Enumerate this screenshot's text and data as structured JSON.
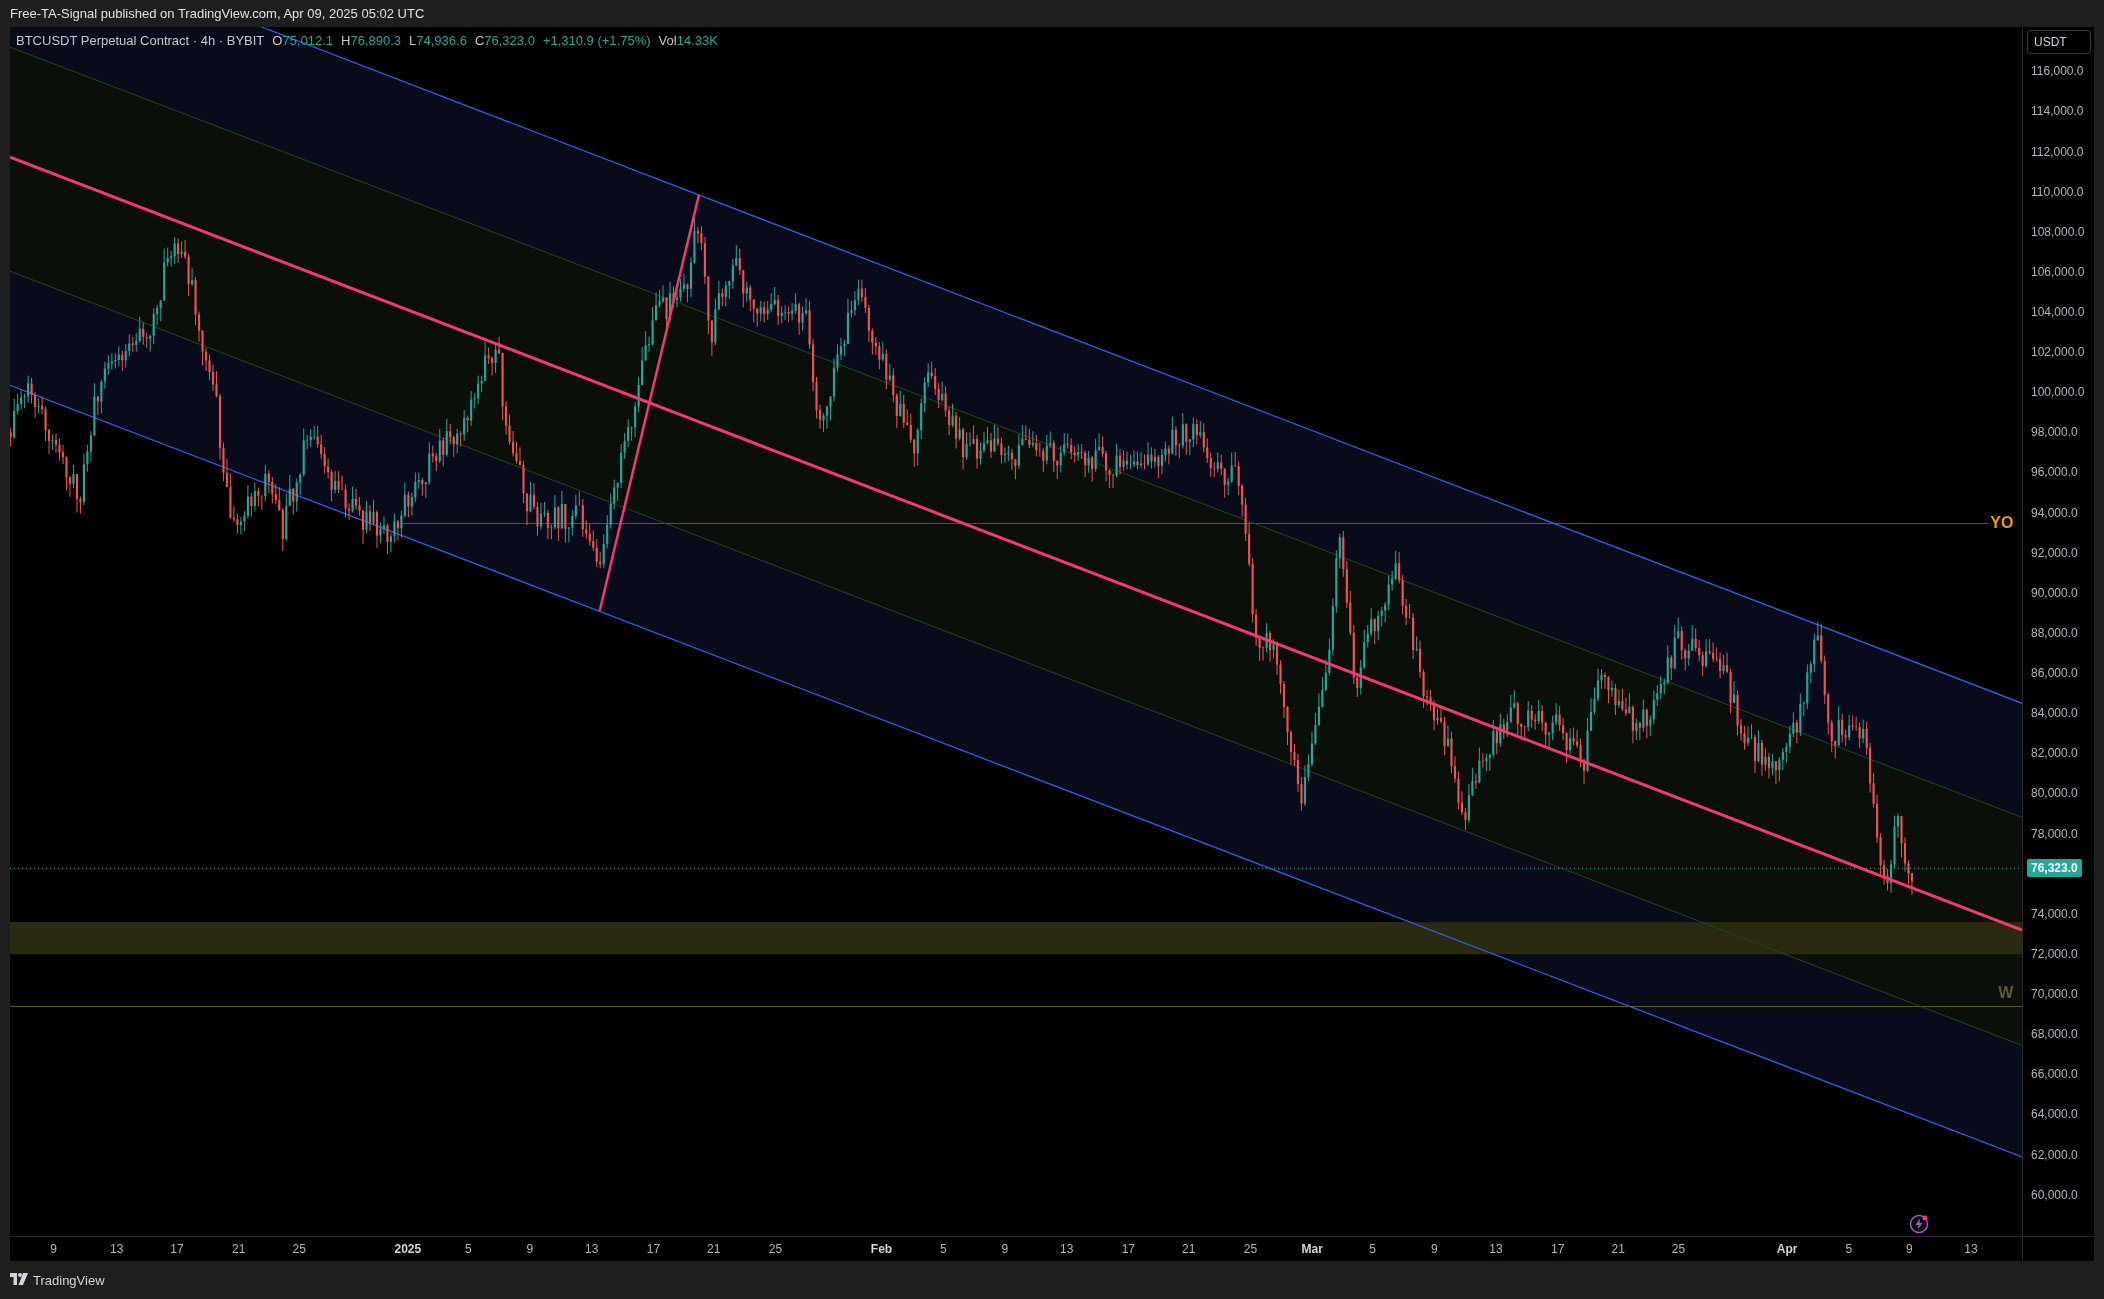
{
  "header": {
    "title": "Free-TA-Signal published on TradingView.com, Apr 09, 2025 05:02 UTC"
  },
  "legend": {
    "symbol": "BTCUSDT Perpetual Contract · 4h · BYBIT",
    "ohlc": [
      {
        "label": "O",
        "value": "75,012.1"
      },
      {
        "label": "H",
        "value": "76,890.3"
      },
      {
        "label": "L",
        "value": "74,936.6"
      },
      {
        "label": "C",
        "value": "76,323.0"
      }
    ],
    "change": "+1,310.9 (+1.75%)",
    "volume_label": "Vol",
    "volume": "14.33K"
  },
  "price_axis": {
    "currency": "USDT",
    "ticks": [
      "116,000.0",
      "114,000.0",
      "112,000.0",
      "110,000.0",
      "108,000.0",
      "106,000.0",
      "104,000.0",
      "102,000.0",
      "100,000.0",
      "98,000.0",
      "96,000.0",
      "94,000.0",
      "92,000.0",
      "90,000.0",
      "88,000.0",
      "86,000.0",
      "84,000.0",
      "82,000.0",
      "80,000.0",
      "78,000.0",
      "74,000.0",
      "72,000.0",
      "70,000.0",
      "68,000.0",
      "66,000.0",
      "64,000.0",
      "62,000.0",
      "60,000.0"
    ],
    "last_price": "76,323.0"
  },
  "levels": [
    {
      "label": "YO",
      "kind": "yearly-open"
    },
    {
      "label": "W",
      "kind": "weekly"
    }
  ],
  "time_axis": [
    {
      "label": "9",
      "major": false
    },
    {
      "label": "13",
      "major": false
    },
    {
      "label": "17",
      "major": false
    },
    {
      "label": "21",
      "major": false
    },
    {
      "label": "25",
      "major": false
    },
    {
      "label": "2025",
      "major": true
    },
    {
      "label": "5",
      "major": false
    },
    {
      "label": "9",
      "major": false
    },
    {
      "label": "13",
      "major": false
    },
    {
      "label": "17",
      "major": false
    },
    {
      "label": "21",
      "major": false
    },
    {
      "label": "25",
      "major": false
    },
    {
      "label": "Feb",
      "major": true
    },
    {
      "label": "5",
      "major": false
    },
    {
      "label": "9",
      "major": false
    },
    {
      "label": "13",
      "major": false
    },
    {
      "label": "17",
      "major": false
    },
    {
      "label": "21",
      "major": false
    },
    {
      "label": "25",
      "major": false
    },
    {
      "label": "Mar",
      "major": true
    },
    {
      "label": "5",
      "major": false
    },
    {
      "label": "9",
      "major": false
    },
    {
      "label": "13",
      "major": false
    },
    {
      "label": "17",
      "major": false
    },
    {
      "label": "21",
      "major": false
    },
    {
      "label": "25",
      "major": false
    },
    {
      "label": "Apr",
      "major": true
    },
    {
      "label": "5",
      "major": false
    },
    {
      "label": "9",
      "major": false
    },
    {
      "label": "13",
      "major": false
    }
  ],
  "footer": {
    "brand": "TradingView"
  }
}
